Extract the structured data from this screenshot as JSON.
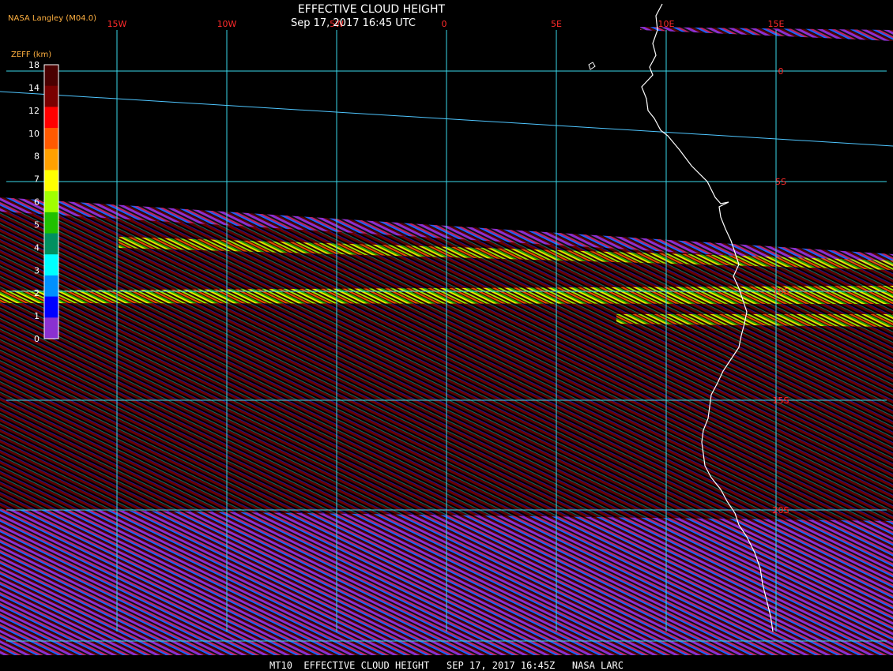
{
  "header": {
    "source": "NASA Langley (M04.0)",
    "title": "EFFECTIVE CLOUD HEIGHT",
    "datetime": "Sep 17, 2017 16:45 UTC"
  },
  "legend": {
    "label": "ZEFF (km)",
    "ticks": [
      "18",
      "14",
      "12",
      "10",
      "8",
      "7",
      "6",
      "5",
      "4",
      "3",
      "2",
      "1",
      "0"
    ],
    "colors": [
      "#4a0000",
      "#7a0000",
      "#ff0000",
      "#ff5a00",
      "#ffa000",
      "#ffff00",
      "#a0ff00",
      "#20c000",
      "#009060",
      "#00ffff",
      "#0090ff",
      "#0000ff",
      "#8a30d0"
    ]
  },
  "map": {
    "lon_labels": [
      "15W",
      "10W",
      "5W",
      "0",
      "5E",
      "10E",
      "15E"
    ],
    "lat_labels": [
      "0",
      "5S",
      "10S",
      "15S",
      "20S"
    ],
    "gridline_color": "#3ad8ea",
    "coastline_color": "#ffffff",
    "label_color": "#ff2a2a"
  },
  "footer": {
    "text": "MT10  EFFECTIVE CLOUD HEIGHT   SEP 17, 2017 16:45Z   NASA LARC"
  }
}
